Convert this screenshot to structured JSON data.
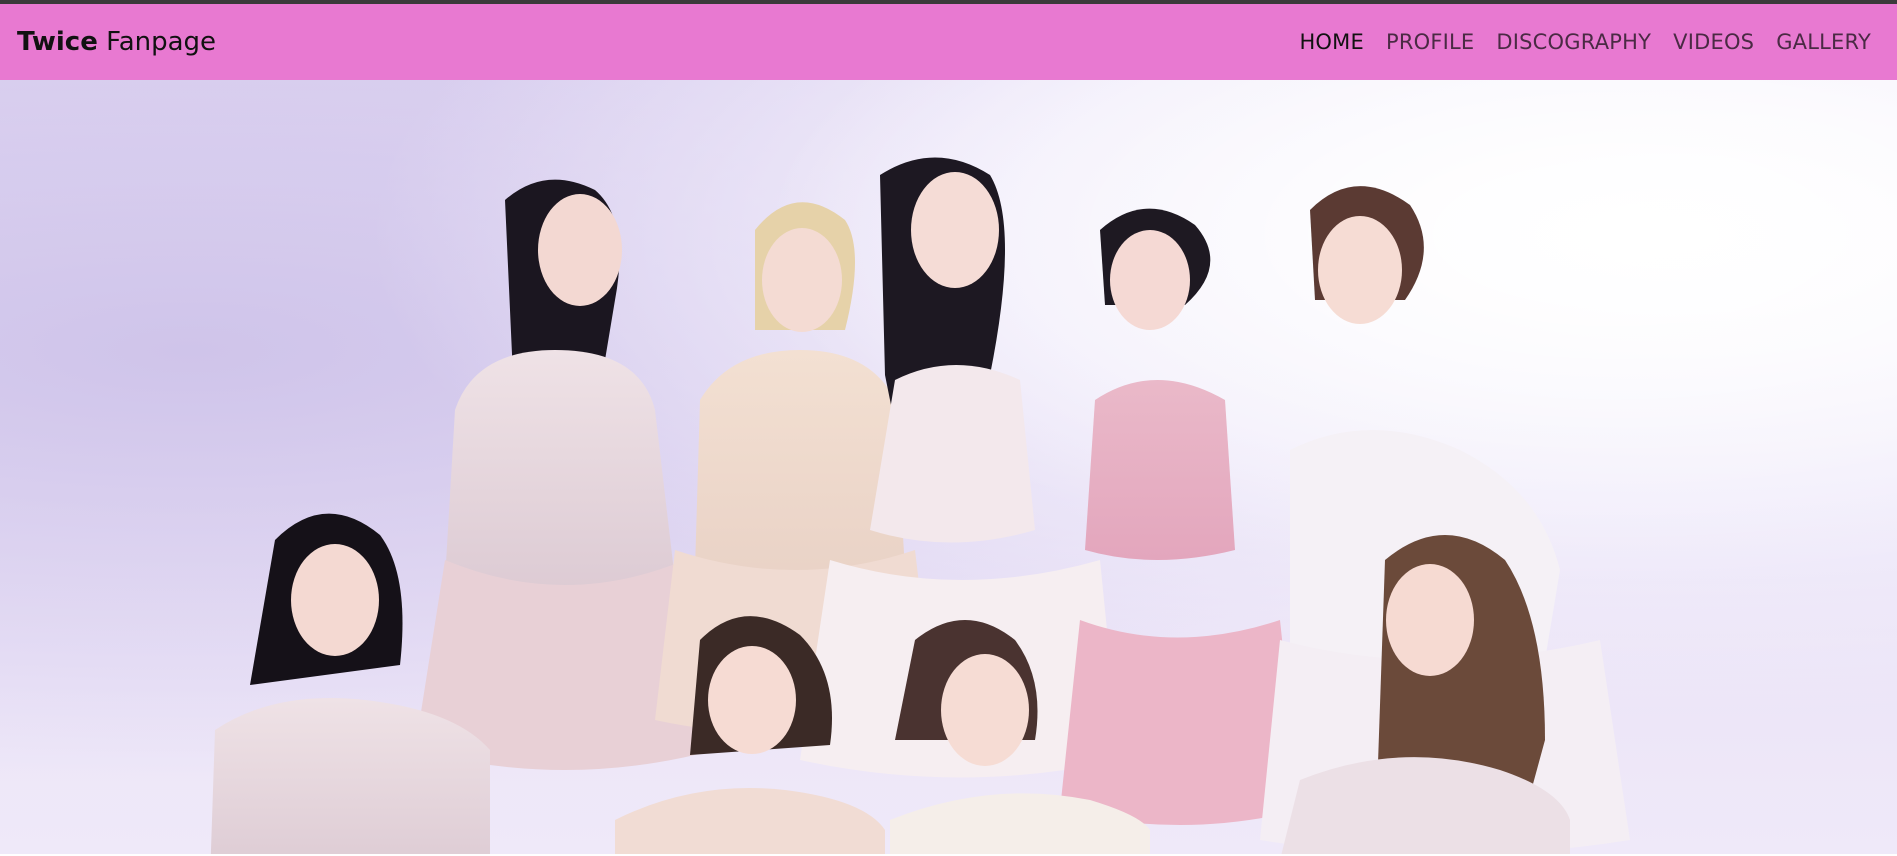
{
  "navbar": {
    "brand_bold": "Twice",
    "brand_light": "Fanpage",
    "links": [
      {
        "label": "HOME",
        "active": true
      },
      {
        "label": "PROFILE",
        "active": false
      },
      {
        "label": "DISCOGRAPHY",
        "active": false
      },
      {
        "label": "VIDEOS",
        "active": false
      },
      {
        "label": "GALLERY",
        "active": false
      }
    ]
  },
  "hero": {
    "image_subject": "group-photo"
  },
  "colors": {
    "navbar_bg": "#e879d1",
    "hero_bg": "#ddd3f1"
  }
}
